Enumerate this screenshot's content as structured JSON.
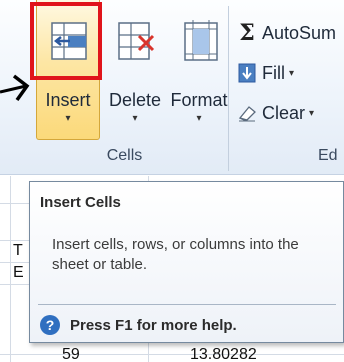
{
  "ribbon": {
    "cells_group": {
      "label": "Cells",
      "buttons": [
        {
          "label": "Insert",
          "dropdown": "▾",
          "icon": "insert-cells-icon"
        },
        {
          "label": "Delete",
          "dropdown": "▾",
          "icon": "delete-cells-icon"
        },
        {
          "label": "Format",
          "dropdown": "▾",
          "icon": "format-cells-icon"
        }
      ]
    },
    "editing_group": {
      "label": "Ed",
      "autosum": {
        "label": "AutoSum",
        "icon_glyph": "Σ"
      },
      "fill": {
        "label": "Fill",
        "dropdown": "▾"
      },
      "clear": {
        "label": "Clear",
        "dropdown": "▾"
      }
    }
  },
  "sheet": {
    "cells": {
      "t_fragment": "T",
      "ex_fragment": "E",
      "row_value": "59",
      "row_value2": "13.80282"
    }
  },
  "tooltip": {
    "title": "Insert Cells",
    "body": "Insert cells, rows, or columns into the sheet or table.",
    "help_icon_glyph": "?",
    "help_text": "Press F1 for more help."
  },
  "colors": {
    "highlight_box": "#e0141b",
    "insert_hover": "#fbd97a",
    "help_icon": "#2f6fc0"
  }
}
